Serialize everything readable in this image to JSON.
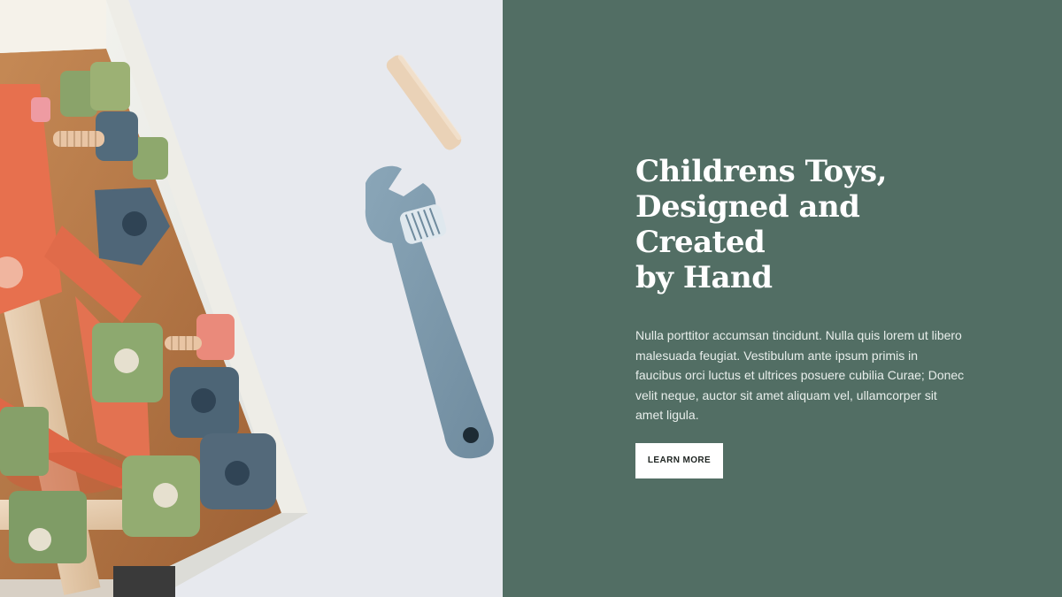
{
  "hero": {
    "heading_line_1": "Childrens Toys,",
    "heading_line_2": "Designed and Created",
    "heading_line_3": "by Hand",
    "body": "Nulla porttitor accumsan tincidunt. Nulla quis lorem ut libero malesuada feugiat. Vestibulum ante ipsum primis in faucibus orci luctus et ultrices posuere cubilia Curae; Donec velit neque, auctor sit amet aliquam vel, ullamcorper sit amet ligula.",
    "cta_label": "LEARN MORE"
  },
  "image": {
    "subject": "wooden toy box with toy wrench",
    "colors": {
      "panel": "#526e64",
      "wrench": "#7c98ab",
      "orange": "#e46f4e",
      "green": "#8aa86d",
      "navy": "#4e6576",
      "wood": "#e7cfb4"
    }
  }
}
